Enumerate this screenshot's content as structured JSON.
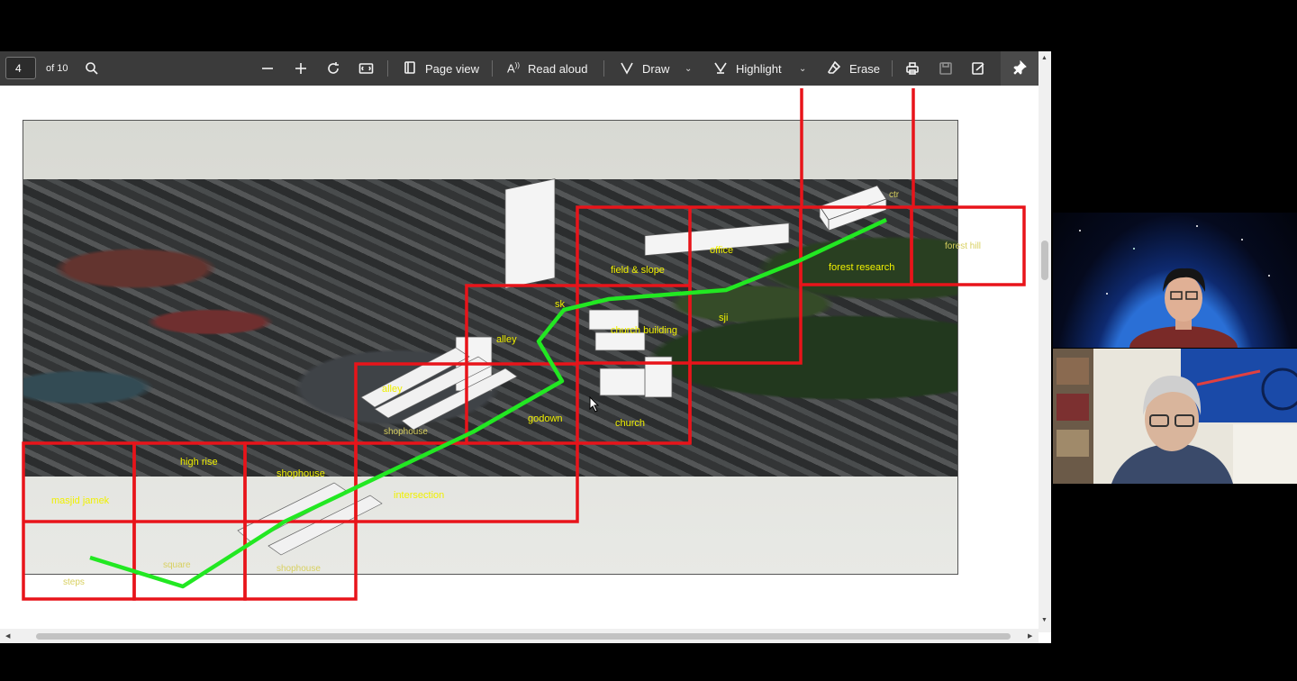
{
  "toolbar": {
    "page_number": "4",
    "page_total": "of 10",
    "page_view_label": "Page view",
    "read_aloud_label": "Read aloud",
    "draw_label": "Draw",
    "highlight_label": "Highlight",
    "erase_label": "Erase"
  },
  "slide_labels": {
    "ctr": "ctr",
    "forest_hill": "forest hill",
    "field_slope": "field & slope",
    "office": "office",
    "forest_research": "forest research",
    "sk": "sk",
    "sji": "sji",
    "alley_top": "alley",
    "church_building": "church building",
    "alley_mid": "alley",
    "godown": "godown",
    "church": "church",
    "shophouse_mid": "shophouse",
    "high_rise": "high rise",
    "shophouse_low": "shophouse",
    "intersection": "intersection",
    "masjid_jamek": "masjid jamek",
    "steps": "steps",
    "square": "square",
    "shophouse_bottom": "shophouse"
  },
  "colors": {
    "grid_box": "#e8141a",
    "path_line": "#22e822",
    "label_text": "#f0f000",
    "toolbar_bg": "#3b3b3b"
  }
}
